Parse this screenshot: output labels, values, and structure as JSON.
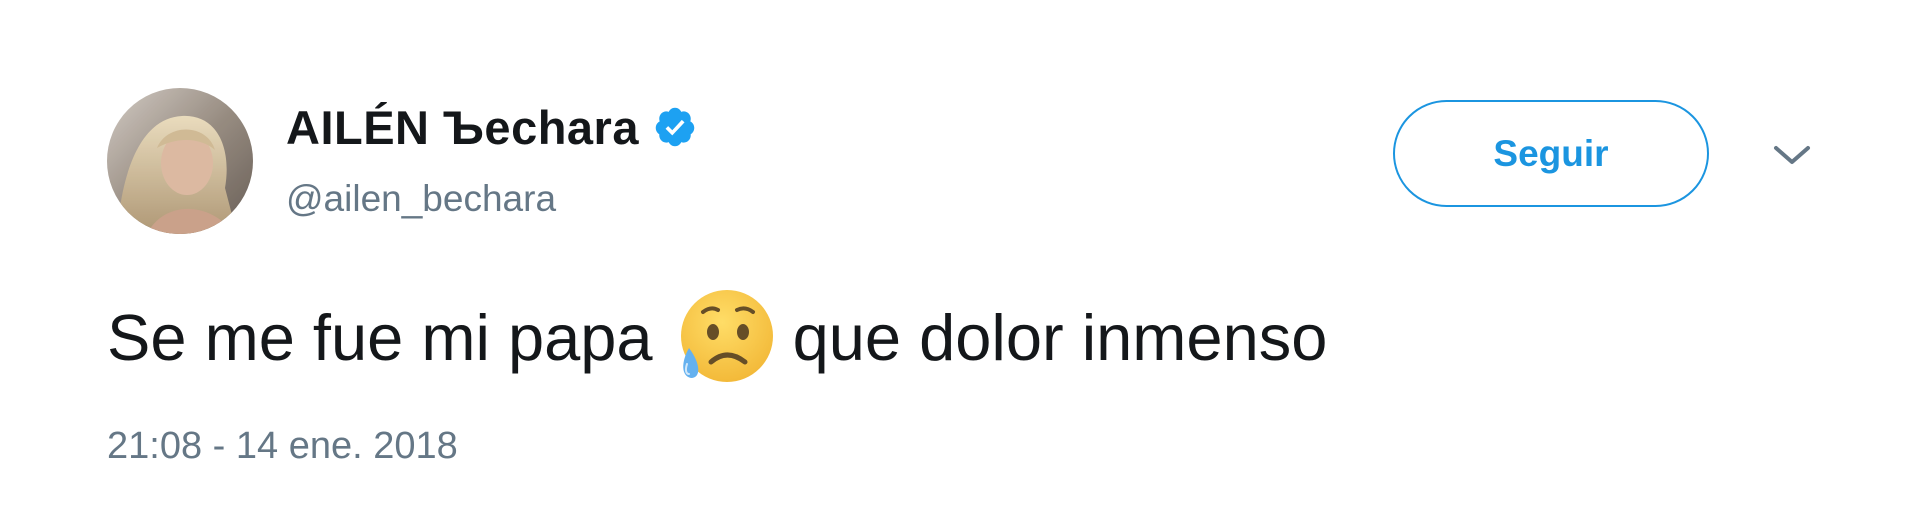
{
  "tweet": {
    "author": {
      "display_name": "AILÉN Ъechara",
      "handle": "@ailen_bechara",
      "verified": true,
      "avatar": "profile-photo"
    },
    "follow_button": {
      "label": "Seguir"
    },
    "menu_icon": "chevron-down-icon",
    "text_before_emoji": "Se me fue mi papa",
    "emoji": "disappointed-but-relieved-face",
    "text_after_emoji": "que dolor inmenso",
    "timestamp": "21:08 - 14 ene. 2018"
  },
  "colors": {
    "accent": "#1b95e0",
    "secondary_text": "#657786",
    "primary_text": "#14171a",
    "verified": "#1da1f2"
  }
}
